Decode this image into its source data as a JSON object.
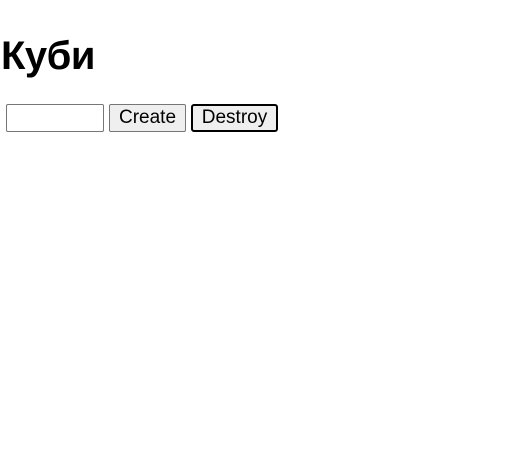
{
  "page": {
    "title": "Куби"
  },
  "controls": {
    "count_input": {
      "value": "",
      "placeholder": ""
    },
    "create_label": "Create",
    "destroy_label": "Destroy"
  }
}
